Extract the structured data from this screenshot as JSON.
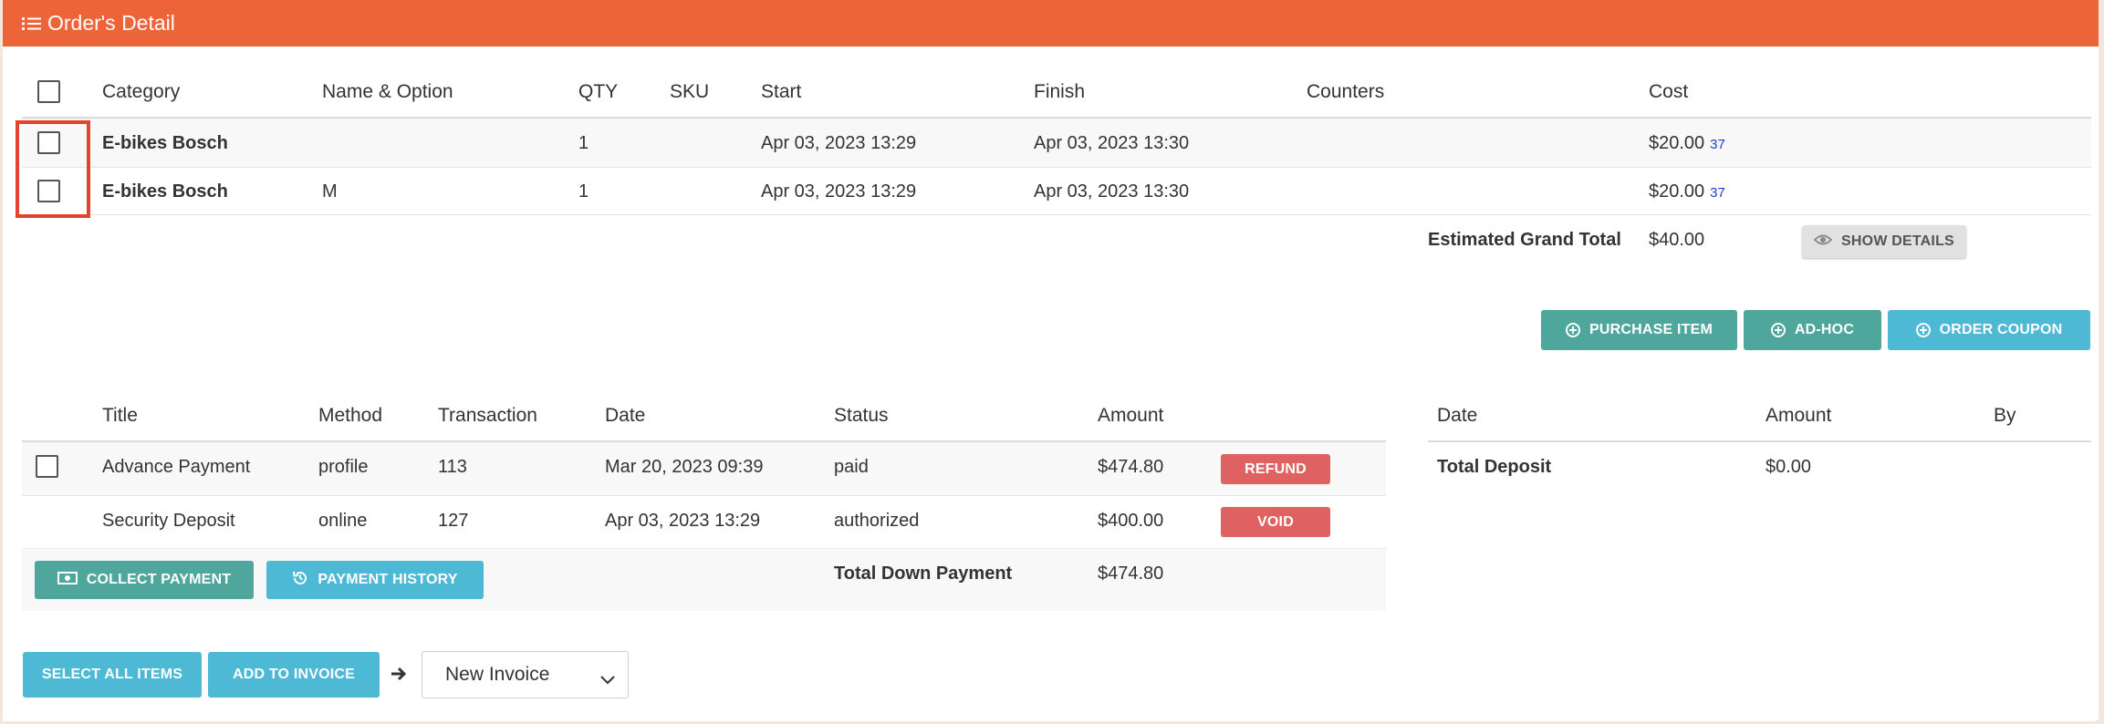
{
  "header": {
    "title": "Order's Detail",
    "icon": "list-icon"
  },
  "items_table": {
    "columns": [
      "Category",
      "Name & Option",
      "QTY",
      "SKU",
      "Start",
      "Finish",
      "Counters",
      "Cost"
    ],
    "rows": [
      {
        "category": "E-bikes Bosch",
        "name_option": "",
        "qty": "1",
        "sku": "",
        "start": "Apr 03, 2023 13:29",
        "finish": "Apr 03, 2023 13:30",
        "counters": "",
        "cost": "$20.00",
        "cost_link": "37"
      },
      {
        "category": "E-bikes Bosch",
        "name_option": "M",
        "qty": "1",
        "sku": "",
        "start": "Apr 03, 2023 13:29",
        "finish": "Apr 03, 2023 13:30",
        "counters": "",
        "cost": "$20.00",
        "cost_link": "37"
      }
    ],
    "grand_total_label": "Estimated Grand Total",
    "grand_total_value": "$40.00",
    "show_details_label": "SHOW DETAILS"
  },
  "item_actions": {
    "purchase_item": "PURCHASE ITEM",
    "ad_hoc": "AD-HOC",
    "order_coupon": "ORDER COUPON"
  },
  "payments_table": {
    "columns": [
      "Title",
      "Method",
      "Transaction",
      "Date",
      "Status",
      "Amount"
    ],
    "rows": [
      {
        "title": "Advance Payment",
        "method": "profile",
        "transaction": "113",
        "date": "Mar 20, 2023 09:39",
        "status": "paid",
        "amount": "$474.80",
        "action": "REFUND"
      },
      {
        "title": "Security Deposit",
        "method": "online",
        "transaction": "127",
        "date": "Apr 03, 2023 13:29",
        "status": "authorized",
        "amount": "$400.00",
        "action": "VOID"
      }
    ],
    "total_label": "Total Down Payment",
    "total_value": "$474.80",
    "collect_payment": "COLLECT PAYMENT",
    "payment_history": "PAYMENT HISTORY"
  },
  "deposit_table": {
    "columns": [
      "Date",
      "Amount",
      "By"
    ],
    "total_label": "Total Deposit",
    "total_value": "$0.00"
  },
  "footer": {
    "select_all": "SELECT ALL ITEMS",
    "add_to_invoice": "ADD TO INVOICE",
    "invoice_select_value": "New Invoice"
  },
  "colors": {
    "header": "#ec6437",
    "teal": "#4fa69c",
    "blue": "#4eb9d4",
    "red": "#e06161",
    "highlight": "#e2452a",
    "link": "#1f3ccf"
  }
}
